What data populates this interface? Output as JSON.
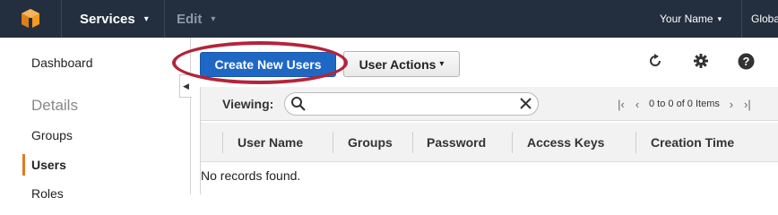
{
  "topbar": {
    "logo_icon": "aws-cube-icon",
    "services_label": "Services",
    "edit_label": "Edit",
    "user_label": "Your Name",
    "region_label": "Global"
  },
  "sidebar": {
    "dashboard": "Dashboard",
    "details_heading": "Details",
    "groups": "Groups",
    "users": "Users",
    "roles": "Roles",
    "active_color": "#e07b24"
  },
  "toolbar": {
    "create_label": "Create New Users",
    "actions_label": "User Actions",
    "refresh_icon": "refresh-icon",
    "settings_icon": "gear-icon",
    "help_icon": "help-icon"
  },
  "grid": {
    "viewing_label": "Viewing:",
    "search_value": "",
    "pager_text": "0 to 0 of 0 Items",
    "columns": [
      "User Name",
      "Groups",
      "Password",
      "Access Keys",
      "Creation Time"
    ],
    "empty_text": "No records found."
  },
  "colors": {
    "primary": "#1f67c4",
    "highlight": "#b3243a"
  }
}
